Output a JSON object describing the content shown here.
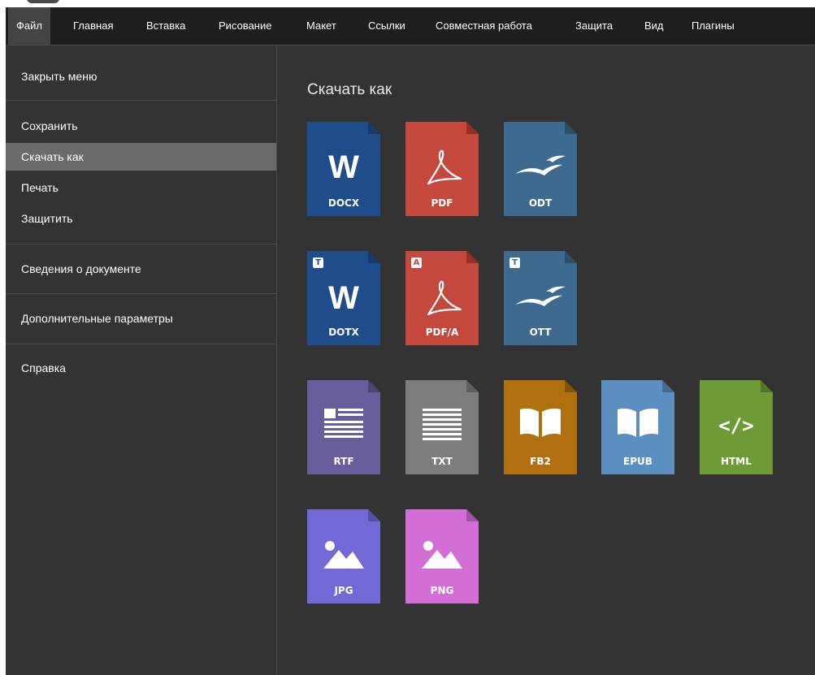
{
  "tabs": [
    "Файл",
    "Главная",
    "Вставка",
    "Рисование",
    "Макет",
    "Ссылки",
    "Совместная работа",
    "Защита",
    "Вид",
    "Плагины"
  ],
  "sidebar": {
    "close_menu": "Закрыть меню",
    "save": "Сохранить",
    "download_as": "Скачать как",
    "print": "Печать",
    "protect": "Защитить",
    "doc_info": "Сведения о документе",
    "advanced": "Дополнительные параметры",
    "help": "Справка"
  },
  "content": {
    "title": "Скачать как",
    "formats": {
      "docx": "DOCX",
      "pdf": "PDF",
      "odt": "ODT",
      "dotx": "DOTX",
      "pdfa": "PDF/A",
      "ott": "OTT",
      "rtf": "RTF",
      "txt": "TXT",
      "fb2": "FB2",
      "epub": "EPUB",
      "html": "HTML",
      "jpg": "JPG",
      "png": "PNG"
    },
    "badges": {
      "dotx": "T",
      "pdfa": "A",
      "ott": "T"
    },
    "glyphs": {
      "word": "W",
      "html": "</>"
    }
  },
  "colors": {
    "docx": "#1f4d8c",
    "pdf": "#c5483d",
    "odt": "#3d6a8e",
    "rtf": "#6a5d9b",
    "txt": "#7d7d7d",
    "fb2": "#b0700f",
    "epub": "#5a8fbf",
    "html": "#6e9b35",
    "jpg": "#7269d6",
    "png": "#d36ed6"
  }
}
